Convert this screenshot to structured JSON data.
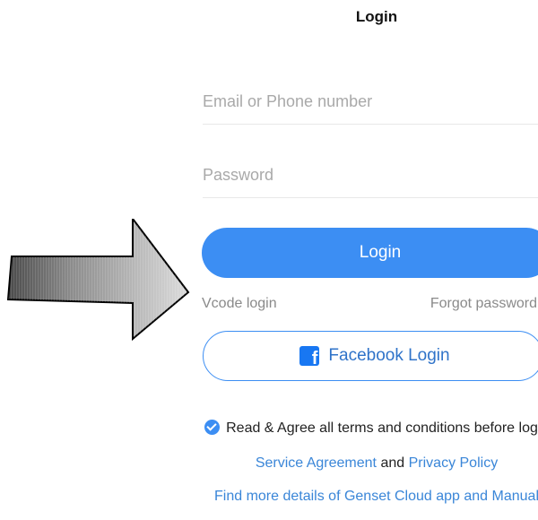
{
  "header": {
    "title": "Login"
  },
  "form": {
    "email_placeholder": "Email or Phone number",
    "password_placeholder": "Password",
    "login_label": "Login",
    "vcode_label": "Vcode login",
    "forgot_label": "Forgot password",
    "facebook_label": "Facebook Login",
    "facebook_icon_letter": "f"
  },
  "terms": {
    "agree_text": "Read & Agree all terms and conditions before login",
    "agreed": true,
    "service_agreement": "Service Agreement",
    "and_text": "and",
    "privacy_policy": "Privacy Policy"
  },
  "footer": {
    "find_more": "Find more details of Genset Cloud app and Manual"
  },
  "colors": {
    "accent": "#3c8ef3",
    "link": "#3a86d8",
    "facebook": "#1877f2",
    "muted": "#8a8a8a"
  },
  "icons": {
    "arrow": "right-arrow-annotation-icon",
    "checkbox": "check-circle-icon",
    "facebook": "facebook-icon"
  }
}
